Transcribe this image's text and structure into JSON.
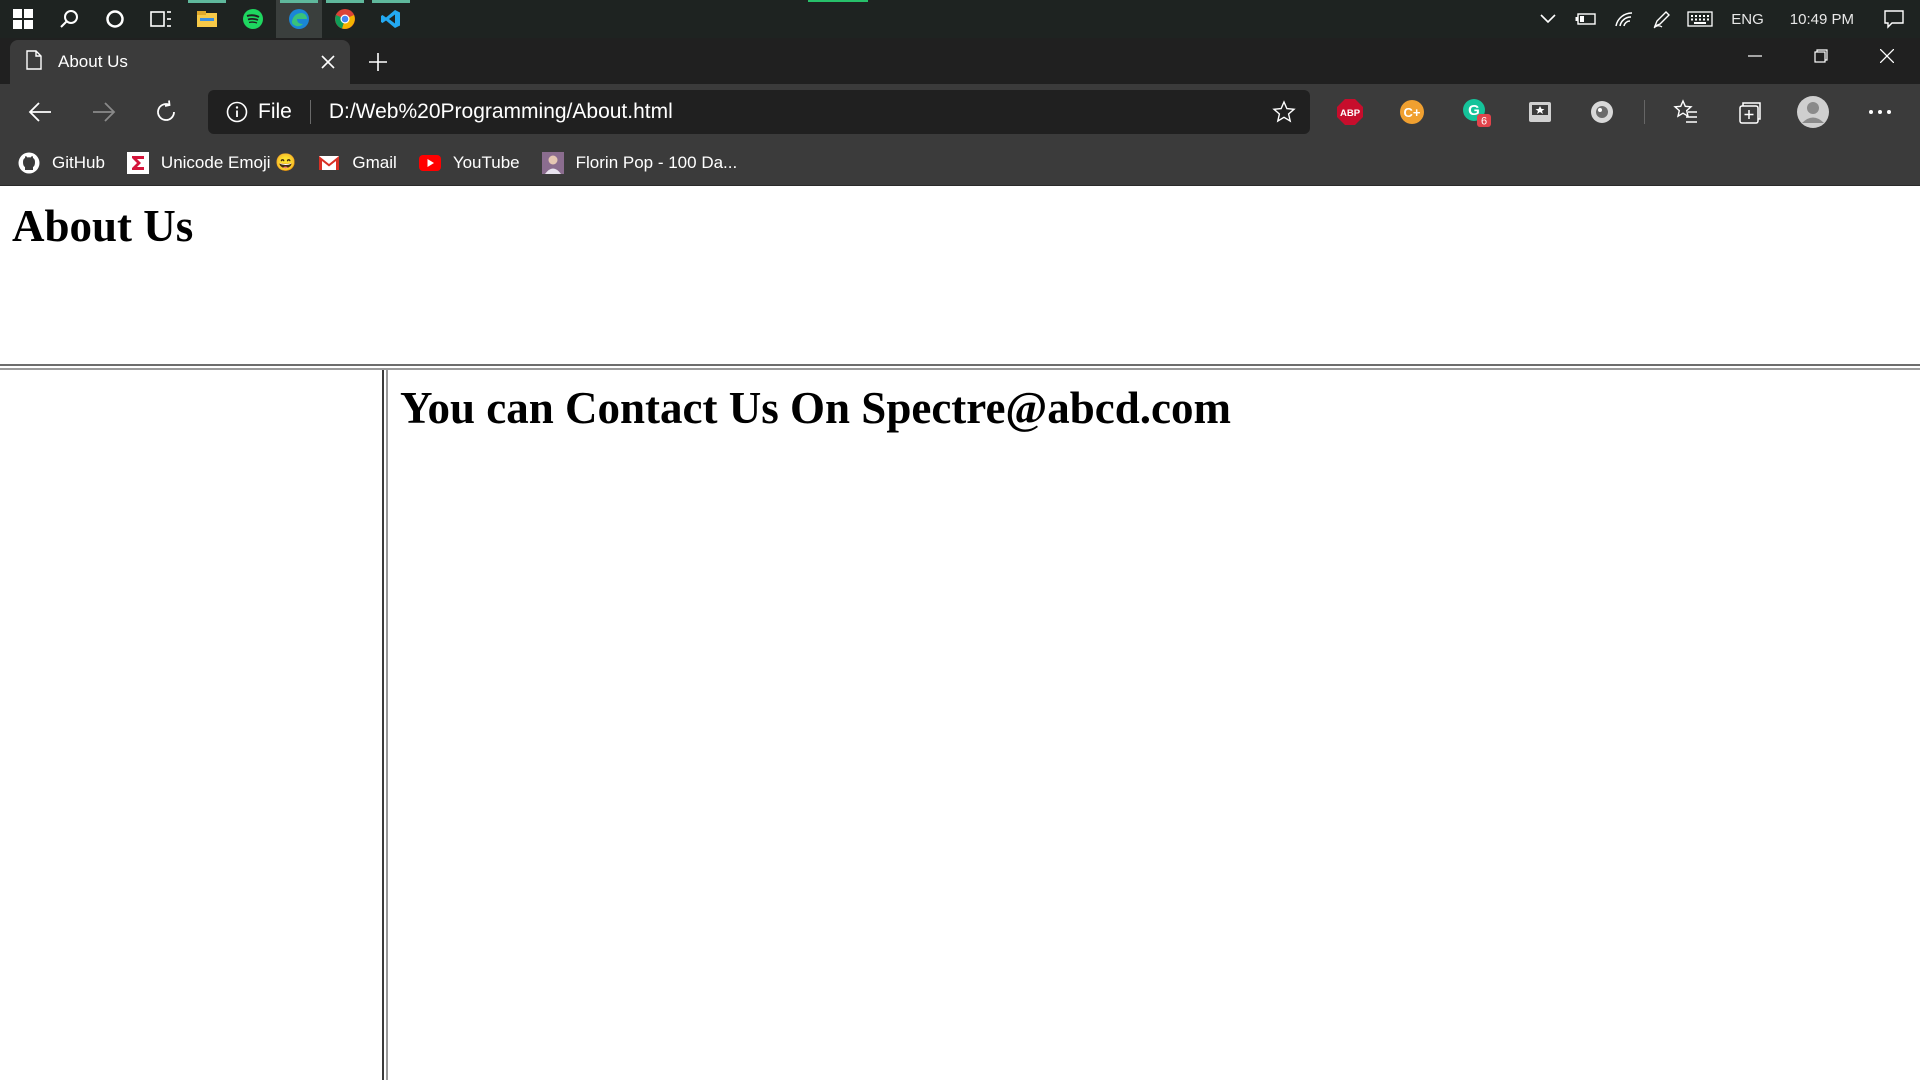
{
  "taskbar": {
    "apps": [
      "start",
      "search",
      "cortana",
      "task-view",
      "file-explorer",
      "spotify",
      "edge",
      "chrome",
      "vscode"
    ],
    "tray": {
      "language": "ENG",
      "clock": "10:49 PM"
    }
  },
  "browser": {
    "tab": {
      "title": "About Us"
    },
    "address": {
      "scheme": "File",
      "url": "D:/Web%20Programming/About.html"
    },
    "extensions": {
      "abp_label": "ABP",
      "notif_badge": "6"
    },
    "bookmarks": [
      {
        "label": "GitHub",
        "icon": "github-icon"
      },
      {
        "label": "Unicode Emoji 😄",
        "icon": "unicode-emoji-icon"
      },
      {
        "label": "Gmail",
        "icon": "gmail-icon"
      },
      {
        "label": "YouTube",
        "icon": "youtube-icon"
      },
      {
        "label": "Florin Pop - 100 Da...",
        "icon": "florin-pop-icon"
      }
    ]
  },
  "page": {
    "title": "About Us",
    "contact": "You can Contact Us On Spectre@abcd.com"
  },
  "colors": {
    "taskbar_bg": "#1e2321",
    "tabstrip_bg": "#202020",
    "toolbar_bg": "#3b3b3b",
    "abp_red": "#c70d2c",
    "honey_orange": "#f0a030",
    "grammarly_green": "#15c39a"
  }
}
